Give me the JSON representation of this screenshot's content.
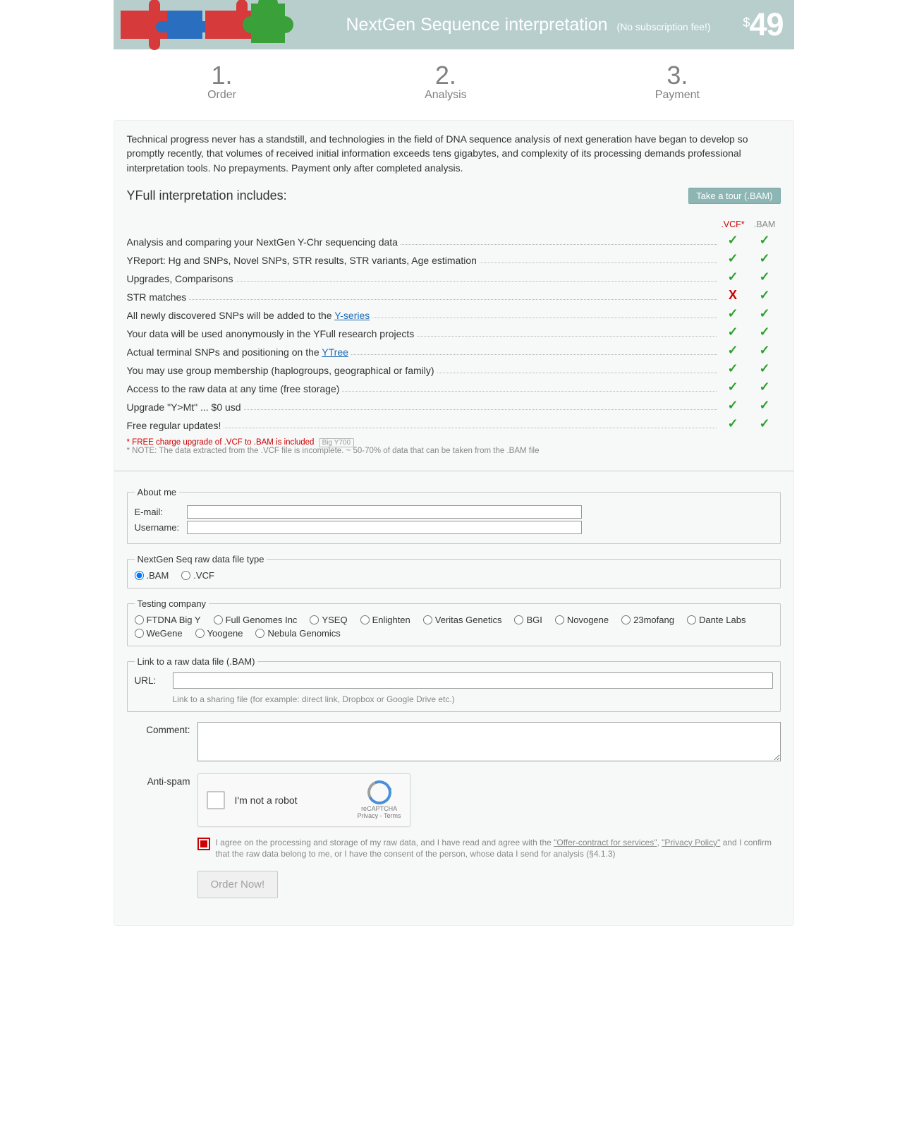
{
  "banner": {
    "title": "NextGen Sequence interpretation",
    "subtitle": "(No subscription fee!)",
    "currency": "$",
    "price": "49"
  },
  "steps": [
    {
      "num": "1.",
      "label": "Order"
    },
    {
      "num": "2.",
      "label": "Analysis"
    },
    {
      "num": "3.",
      "label": "Payment"
    }
  ],
  "intro": "Technical progress never has a standstill, and technologies in the field of DNA sequence analysis of next generation have began to develop so promptly recently, that volumes of received initial information exceeds tens gigabytes, and complexity of its processing demands professional interpretation tools. No prepayments. Payment only after completed analysis.",
  "includes_title": "YFull interpretation includes:",
  "tour_btn": "Take a tour (.BAM)",
  "columns": {
    "vcf": ".VCF*",
    "bam": ".BAM"
  },
  "features": [
    {
      "text": "Analysis and comparing your NextGen Y-Chr sequencing data",
      "vcf": "✓",
      "bam": "✓"
    },
    {
      "text": "YReport: Hg and SNPs, Novel SNPs, STR results, STR variants, Age estimation",
      "vcf": "✓",
      "bam": "✓"
    },
    {
      "text": "Upgrades, Comparisons",
      "vcf": "✓",
      "bam": "✓"
    },
    {
      "text": "STR matches",
      "vcf": "✗",
      "bam": "✓"
    },
    {
      "text_pre": "All newly discovered SNPs will be added to the ",
      "link": "Y-series",
      "vcf": "✓",
      "bam": "✓"
    },
    {
      "text": "Your data will be used anonymously in the YFull research projects",
      "vcf": "✓",
      "bam": "✓"
    },
    {
      "text_pre": "Actual terminal SNPs and positioning on the ",
      "link": "YTree",
      "vcf": "✓",
      "bam": "✓"
    },
    {
      "text": "You may use group membership (haplogroups, geographical or family)",
      "vcf": "✓",
      "bam": "✓"
    },
    {
      "text": "Access to the raw data at any time (free storage)",
      "vcf": "✓",
      "bam": "✓"
    },
    {
      "text": "Upgrade \"Y>Mt\" ... $0 usd",
      "vcf": "✓",
      "bam": "✓"
    },
    {
      "text": "Free regular updates!",
      "vcf": "✓",
      "bam": "✓"
    }
  ],
  "notes": {
    "line1": "* FREE charge upgrade of .VCF to .BAM is included",
    "badge": "Big Y700",
    "line2": "* NOTE: The data extracted from the .VCF file is incomplete. ~ 50-70% of data that can be taken from the .BAM file"
  },
  "about": {
    "legend": "About me",
    "email_label": "E-mail:",
    "username_label": "Username:",
    "email": "",
    "username": ""
  },
  "filetype": {
    "legend": "NextGen Seq raw data file type",
    "options": [
      ".BAM",
      ".VCF"
    ],
    "selected": ".BAM"
  },
  "company": {
    "legend": "Testing company",
    "options": [
      "FTDNA Big Y",
      "Full Genomes Inc",
      "YSEQ",
      "Enlighten",
      "Veritas Genetics",
      "BGI",
      "Novogene",
      "23mofang",
      "Dante Labs",
      "WeGene",
      "Yoogene",
      "Nebula Genomics"
    ]
  },
  "link": {
    "legend": "Link to a raw data file (.BAM)",
    "url_label": "URL:",
    "url": "",
    "hint": "Link to a sharing file (for example: direct link, Dropbox or Google Drive etc.)"
  },
  "comment_label": "Comment:",
  "comment": "",
  "antispam_label": "Anti-spam",
  "recaptcha": {
    "text": "I'm not a robot",
    "brand": "reCAPTCHA",
    "terms": "Privacy - Terms"
  },
  "consent": {
    "pre": "I agree on the processing and storage of my raw data, and I have read and agree with the ",
    "link1": "\"Offer-contract for services\"",
    "mid": ", ",
    "link2": "\"Privacy Policy\"",
    "post": " and I confirm that the raw data belong to me, or I have the consent of the person, whose data I send for analysis (§4.1.3)"
  },
  "order_btn": "Order Now!"
}
